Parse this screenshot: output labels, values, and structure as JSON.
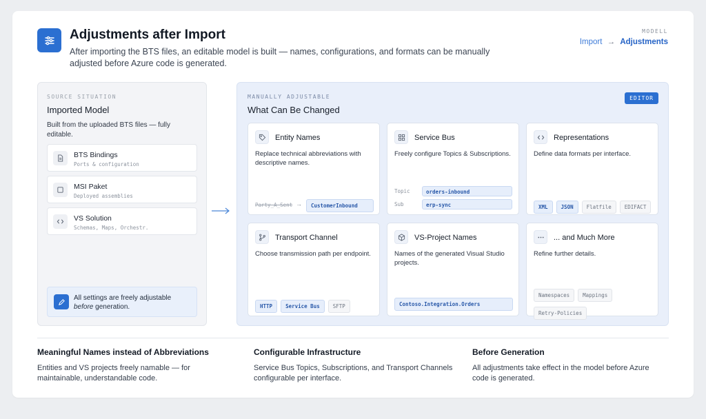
{
  "header": {
    "title": "Adjustments after Import",
    "subtitle": "After importing the BTS files, an editable model is built — names, configurations, and formats can be manually adjusted before Azure  code is generated.",
    "icon": "sliders-icon"
  },
  "breadcrumb": {
    "label": "MODELL",
    "step1": "Import",
    "arrow": "→",
    "step2": "Adjustments"
  },
  "source": {
    "eyebrow": "SOURCE SITUATION",
    "title": "Imported Model",
    "description": "Built from the uploaded BTS files — fully editable.",
    "items": [
      {
        "name": "BTS Bindings",
        "sub": "Ports & configuration",
        "icon": "file-icon"
      },
      {
        "name": "MSI Paket",
        "sub": "Deployed assemblies",
        "icon": "package-icon"
      },
      {
        "name": "VS Solution",
        "sub": "Schemas, Maps, Orchestr.",
        "icon": "code-icon"
      }
    ],
    "note_prefix": "All settings are freely adjustable",
    "note_em": "before",
    "note_suffix": " generation."
  },
  "editable": {
    "eyebrow": "MANUALLY ADJUSTABLE",
    "title": "What Can Be Changed",
    "badge": "EDITOR",
    "entity": {
      "title": "Entity Names",
      "desc": "Replace technical abbreviations with descriptive names.",
      "old": "Party_A_Sent",
      "arrow": "→",
      "new": "CustomerInbound"
    },
    "servicebus": {
      "title": "Service Bus",
      "desc": "Freely configure Topics & Subscriptions.",
      "topic_key": "Topic",
      "topic_val": "orders-inbound",
      "sub_key": "Sub",
      "sub_val": "erp-sync"
    },
    "representations": {
      "title": "Representations",
      "desc": "Define data formats per interface.",
      "chips": [
        "XML",
        "JSON",
        "Flatfile",
        "EDIFACT"
      ]
    },
    "transport": {
      "title": "Transport Channel",
      "desc": "Choose transmission path per endpoint.",
      "chips": [
        "HTTP",
        "Service Bus",
        "SFTP"
      ]
    },
    "vsproject": {
      "title": "VS-Project Names",
      "desc": "Names of the generated Visual Studio projects.",
      "value": "Contoso.Integration.Orders"
    },
    "more": {
      "title": "... and Much More",
      "desc": "Refine further details.",
      "chips": [
        "Namespaces",
        "Mappings",
        "Retry-Policies"
      ]
    }
  },
  "benefits": [
    {
      "title": "Meaningful Names instead of Abbreviations",
      "text": "Entities and VS projects freely namable — for maintainable, understandable code."
    },
    {
      "title": "Configurable Infrastructure",
      "text": "Service Bus Topics, Subscriptions, and Transport Channels configurable per interface."
    },
    {
      "title": "Before Generation",
      "text": "All adjustments take effect in the model before Azure code is generated."
    }
  ]
}
